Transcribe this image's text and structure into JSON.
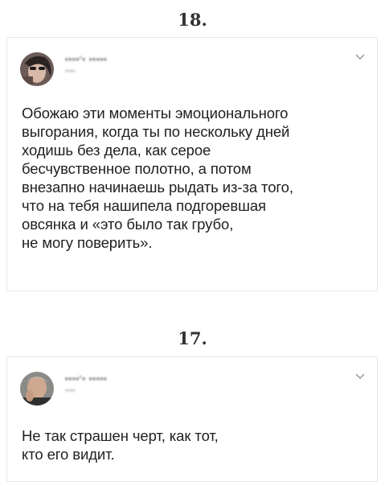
{
  "posts": [
    {
      "number": "18.",
      "author_name": "▪︎▪︎▪︎▪︎'▪︎ ▪︎▪︎▪︎▪︎▪︎",
      "author_handle": "▪︎▪︎▪︎▪︎",
      "text": "Обожаю эти моменты эмоционального\nвыгорания, когда ты по нескольку дней\nходишь без дела, как серое\nбесчувственное полотно, а потом\nвнезапно начинаешь рыдать из-за того,\nчто на тебя нашипела подгоревшая\nовсянка и «это было так грубо,\nне могу поверить»."
    },
    {
      "number": "17.",
      "author_name": "▪︎▪︎▪︎▪︎'▪︎ ▪︎▪︎▪︎▪︎▪︎",
      "author_handle": "▪︎▪︎▪︎▪︎",
      "text": "Не так страшен черт, как тот,\nкто его видит."
    }
  ],
  "icons": {
    "menu": "chevron-down-icon",
    "avatar": "avatar"
  },
  "colors": {
    "border": "#e1e8ed",
    "text": "#1f1f1f",
    "chevron": "#8899a6"
  }
}
